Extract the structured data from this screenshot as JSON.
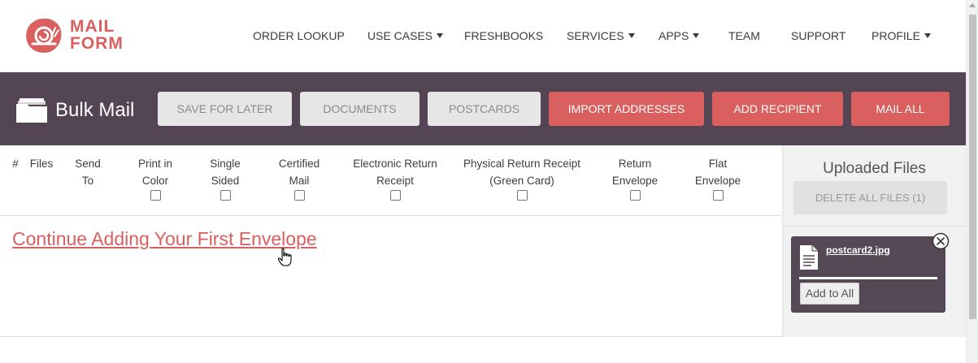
{
  "brand": {
    "line1": "MAIL",
    "line2": "FORM",
    "color": "#d9605f"
  },
  "nav": {
    "items": [
      {
        "label": "ORDER LOOKUP",
        "dropdown": false
      },
      {
        "label": "USE CASES",
        "dropdown": true
      },
      {
        "label": "FRESHBOOKS",
        "dropdown": false
      },
      {
        "label": "SERVICES",
        "dropdown": true
      },
      {
        "label": "APPS",
        "dropdown": true
      },
      {
        "label": "TEAM",
        "dropdown": false
      },
      {
        "label": "SUPPORT",
        "dropdown": false
      },
      {
        "label": "PROFILE",
        "dropdown": true
      }
    ]
  },
  "header": {
    "icon": "folder-icon",
    "title": "Bulk Mail",
    "bar_color": "#534554",
    "buttons": {
      "save_for_later": "SAVE FOR LATER",
      "documents": "DOCUMENTS",
      "postcards": "POSTCARDS",
      "import_addresses": "IMPORT ADDRESSES",
      "add_recipient": "ADD RECIPIENT",
      "mail_all": "MAIL ALL"
    }
  },
  "table": {
    "columns": {
      "num": {
        "line1": "#"
      },
      "files": {
        "line1": "Files"
      },
      "send_to": {
        "line1": "Send",
        "line2": "To"
      },
      "print_color": {
        "line1": "Print in",
        "line2": "Color",
        "checked": false
      },
      "single_sided": {
        "line1": "Single",
        "line2": "Sided",
        "checked": false
      },
      "certified": {
        "line1": "Certified",
        "line2": "Mail",
        "checked": false
      },
      "electronic_return": {
        "line1": "Electronic Return",
        "line2": "Receipt",
        "checked": false
      },
      "physical_return": {
        "line1": "Physical Return Receipt",
        "line2": "(Green Card)",
        "checked": false
      },
      "return_envelope": {
        "line1": "Return",
        "line2": "Envelope",
        "checked": false
      },
      "flat_envelope": {
        "line1": "Flat",
        "line2": "Envelope",
        "checked": false
      }
    }
  },
  "content": {
    "continue_link": "Continue Adding Your First Envelope"
  },
  "uploads": {
    "title": "Uploaded Files",
    "delete_all": "DELETE ALL FILES (1)",
    "file": {
      "name": "postcard2.jpg",
      "icon": "document-icon",
      "progress": 1.0
    },
    "add_to_all": "Add to All"
  }
}
